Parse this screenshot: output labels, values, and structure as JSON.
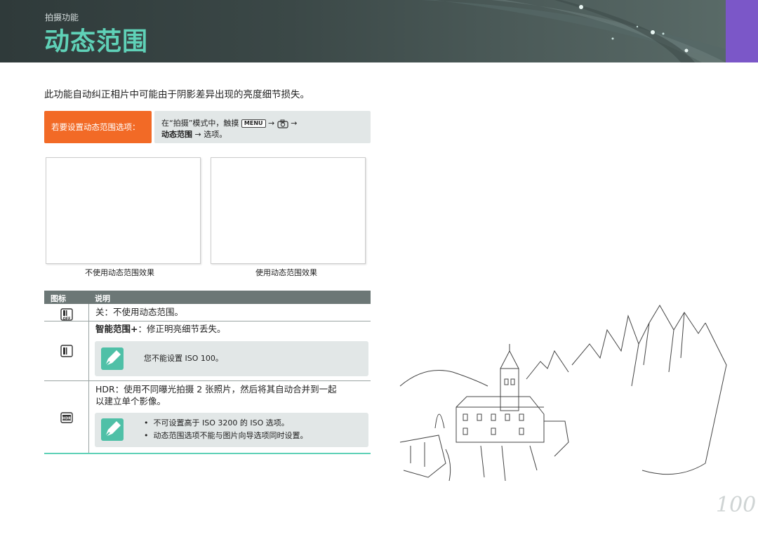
{
  "header": {
    "breadcrumb": "拍摄功能",
    "title": "动态范围"
  },
  "intro": "此功能自动纠正相片中可能由于阴影差异出现的亮度细节损失。",
  "instruction": {
    "label": "若要设置动态范围选项：",
    "line1_prefix": "在“拍摄”模式中，触摸",
    "menu_key": "MENU",
    "arrow": "→",
    "line2_bold": "动态范围",
    "line2_rest": " → 选项。"
  },
  "photos": {
    "left_caption": "不使用动态范围效果",
    "right_caption": "使用动态范围效果"
  },
  "table": {
    "col_icon": "图标",
    "col_desc": "说明",
    "rows": [
      {
        "icon": "dr-off-icon",
        "label": "关",
        "text": "：不使用动态范围。"
      },
      {
        "icon": "dr-smart-icon",
        "label": "智能范围+",
        "text": "：修正明亮细节丢失。",
        "note": "您不能设置 ISO 100。"
      },
      {
        "icon": "hdr-icon",
        "label": "HDR",
        "text_line1": "：使用不同曝光拍摄 2 张照片，然后将其自动合并到一起",
        "text_line2": "以建立单个影像。",
        "notes": [
          "不可设置高于 ISO 3200 的 ISO 选项。",
          "动态范围选项不能与图片向导选项同时设置。"
        ]
      }
    ]
  },
  "page_number": "100",
  "colors": {
    "accent": "#5fd1b7",
    "orange": "#f26a26",
    "purple": "#7b57c8",
    "header_bg": "#3b4847"
  }
}
